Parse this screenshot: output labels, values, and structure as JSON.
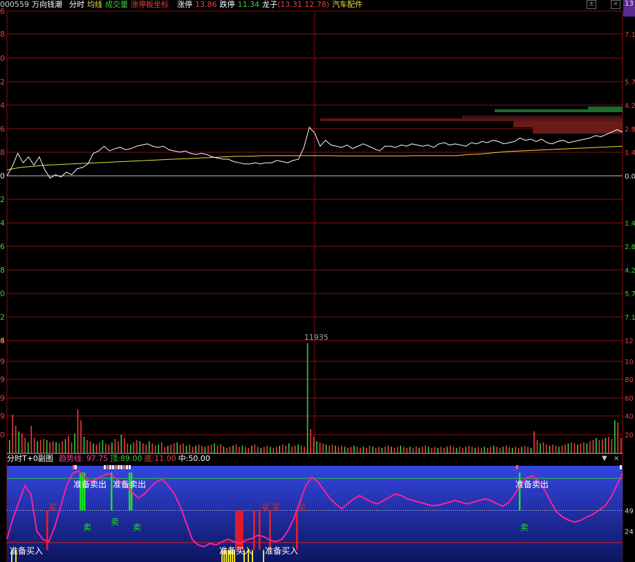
{
  "header": {
    "code": "000559",
    "name": "万向钱潮",
    "items": [
      "分时",
      "均线",
      "成交量",
      "涨停板坐标"
    ],
    "limit_up_label": "涨停",
    "limit_up_value": "13.86",
    "limit_down_label": "跌停",
    "limit_down_value": "11.34",
    "dragon_label": "龙子",
    "dragon_value": "(13.31 12.78)",
    "sector": "汽车配件",
    "right_tag": "13"
  },
  "subpanel": {
    "title": "分时T+0副图",
    "trend_label": "趋势线:",
    "trend_value": "97.75",
    "top_label": "顶:",
    "top_value": "89.00",
    "bottom_label": "底:",
    "bottom_value": "11.00",
    "mid_label": "中:",
    "mid_value": "50.00",
    "dropdown_symbol": "▼",
    "close_symbol": "×"
  },
  "colors": {
    "price_line": "#ffffff",
    "avg_line": "#e6e23a",
    "grid_red": "#8c1010",
    "up_text": "#e84040",
    "down_text": "#3ad03a",
    "trend_line": "#ff1f9e",
    "sub_background": "#2030b8",
    "sell_marker": "#1ee21e",
    "buy_marker": "#ff1a1a"
  },
  "chart_data": [
    {
      "type": "line",
      "panel": "price",
      "left_axis_labels": [
        "6",
        "8",
        "0",
        "2",
        "4",
        "6",
        "8",
        "0",
        "2",
        "4",
        "6",
        "8",
        "0",
        "2",
        "4",
        "6"
      ],
      "right_axis_labels": [
        "",
        "7.1",
        "5.7",
        "4.2",
        "2.8",
        "1.4",
        "0.0",
        "1.4",
        "2.8",
        "4.2",
        "5.7",
        "7.1"
      ],
      "series": [
        {
          "values": [
            0.0,
            0.8,
            1.9,
            1.1,
            1.6,
            0.9,
            1.6,
            0.5,
            -0.2,
            0.1,
            -0.1,
            0.3,
            0.1,
            0.6,
            0.7,
            1.0,
            1.9,
            2.1,
            2.5,
            2.1,
            2.3,
            2.4,
            2.2,
            2.3,
            2.5,
            2.6,
            2.7,
            2.5,
            2.4,
            2.5,
            2.2,
            2.1,
            2.0,
            2.1,
            1.9,
            1.8,
            1.9,
            1.8,
            1.6,
            1.5,
            1.4,
            1.4,
            1.2,
            1.1,
            1.0,
            1.0,
            1.1,
            1.0,
            1.1,
            1.1,
            1.3,
            1.2,
            1.1,
            1.3,
            1.4,
            2.4,
            4.1,
            3.6,
            2.5,
            3.0,
            2.6,
            2.5,
            2.4,
            2.6,
            2.3,
            2.5,
            2.7,
            2.5,
            2.3,
            2.1,
            2.5,
            2.5,
            2.4,
            2.6,
            2.5,
            2.7,
            2.6,
            2.5,
            2.6,
            2.4,
            2.7,
            2.8,
            2.6,
            2.7,
            2.6,
            2.5,
            2.8,
            2.7,
            2.9,
            2.8,
            3.0,
            2.9,
            2.7,
            2.8,
            2.9,
            3.2,
            3.0,
            3.1,
            2.9,
            3.1,
            2.8,
            2.7,
            2.9,
            3.0,
            2.8,
            2.9,
            3.0,
            3.1,
            3.2,
            3.4,
            3.3,
            3.5,
            3.7,
            3.9,
            3.7
          ]
        },
        {
          "values": [
            0.5,
            0.7,
            0.8,
            0.9,
            0.95,
            1.0,
            1.05,
            1.1,
            1.15,
            1.2,
            1.25,
            1.3,
            1.35,
            1.4,
            1.45,
            1.5,
            1.55,
            1.6,
            1.65,
            1.65,
            1.7,
            1.7,
            1.7,
            1.7,
            1.7,
            1.7,
            1.68,
            1.68,
            1.68,
            1.68,
            1.68,
            1.68,
            1.7,
            1.7,
            1.7,
            1.7,
            1.8,
            1.85,
            1.95,
            2.05,
            2.1,
            2.15,
            2.2,
            2.25,
            2.3,
            2.35,
            2.4,
            2.45,
            2.5
          ]
        }
      ]
    },
    {
      "type": "bar",
      "panel": "volume",
      "peak_label": "11935",
      "left_axis_labels": [
        "8",
        "9",
        "9",
        "9",
        "9",
        "0"
      ],
      "right_axis_labels": [
        "12",
        "10",
        "80",
        "60",
        "40",
        "20"
      ],
      "values": [
        12,
        35,
        25,
        20,
        18,
        14,
        10,
        25,
        14,
        11,
        12,
        13,
        12,
        10,
        11,
        10,
        9,
        11,
        13,
        16,
        10,
        18,
        40,
        30,
        15,
        12,
        11,
        9,
        8,
        10,
        12,
        9,
        8,
        10,
        13,
        11,
        17,
        14,
        9,
        8,
        10,
        12,
        11,
        9,
        8,
        11,
        9,
        7,
        8,
        10,
        6,
        7,
        8,
        9,
        10,
        8,
        9,
        7,
        8,
        6,
        7,
        8,
        7,
        6,
        7,
        8,
        9,
        7,
        8,
        6,
        5,
        6,
        7,
        8,
        6,
        7,
        6,
        5,
        7,
        8,
        6,
        5,
        6,
        7,
        6,
        5,
        6,
        7,
        8,
        7,
        9,
        6,
        7,
        8,
        7,
        6,
        100,
        22,
        15,
        11,
        10,
        9,
        8,
        7,
        8,
        7,
        6,
        7,
        6,
        5,
        6,
        7,
        6,
        5,
        6,
        5,
        7,
        6,
        5,
        6,
        5,
        6,
        7,
        6,
        5,
        6,
        7,
        6,
        5,
        6,
        5,
        6,
        5,
        6,
        7,
        6,
        5,
        6,
        5,
        6,
        5,
        6,
        7,
        6,
        5,
        6,
        5,
        6,
        7,
        6,
        5,
        6,
        5,
        6,
        5,
        6,
        7,
        6,
        5,
        6,
        7,
        6,
        5,
        6,
        5,
        6,
        7,
        6,
        5,
        20,
        12,
        9,
        10,
        8,
        7,
        8,
        7,
        6,
        7,
        8,
        9,
        10,
        9,
        8,
        9,
        10,
        9,
        11,
        12,
        14,
        12,
        13,
        14,
        15,
        13,
        30,
        28,
        14
      ]
    },
    {
      "type": "line",
      "panel": "indicator",
      "right_axis_labels": [
        "49",
        "24"
      ],
      "series": [
        {
          "values": [
            15,
            40,
            60,
            80,
            70,
            25,
            15,
            12,
            30,
            55,
            80,
            95,
            98,
            90,
            85,
            88,
            92,
            95,
            90,
            85,
            80,
            72,
            65,
            70,
            78,
            85,
            88,
            80,
            70,
            55,
            35,
            15,
            8,
            6,
            10,
            8,
            12,
            15,
            12,
            10,
            14,
            16,
            20,
            18,
            14,
            12,
            15,
            25,
            40,
            60,
            80,
            90,
            85,
            75,
            65,
            58,
            52,
            58,
            64,
            68,
            64,
            60,
            58,
            62,
            66,
            70,
            68,
            64,
            62,
            60,
            58,
            56,
            56,
            58,
            60,
            62,
            60,
            58,
            60,
            62,
            64,
            62,
            58,
            55,
            60,
            70,
            82,
            90,
            92,
            85,
            75,
            60,
            48,
            42,
            38,
            36,
            38,
            42,
            45,
            50,
            55,
            65,
            80,
            95
          ]
        }
      ],
      "annotations": [
        "准备卖出",
        "准备卖出",
        "准备卖出",
        "卖",
        "卖",
        "卖",
        "卖",
        "买",
        "买",
        "买",
        "买",
        "准备买入",
        "准备买入",
        "准备买入"
      ]
    }
  ]
}
